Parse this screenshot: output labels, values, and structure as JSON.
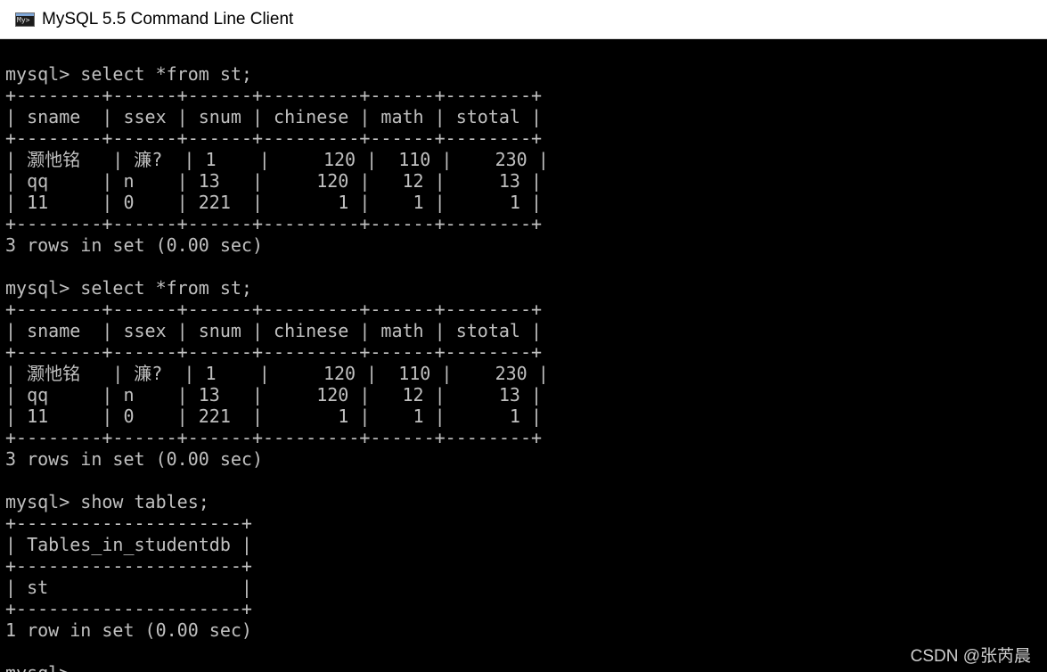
{
  "window": {
    "title": "MySQL 5.5 Command Line Client",
    "icon": "mysql-console-icon"
  },
  "console": {
    "lines": [
      "mysql> select *from st;",
      "+--------+------+------+---------+------+--------+",
      "| sname  | ssex | snum | chinese | math | stotal |",
      "+--------+------+------+---------+------+--------+",
      "| 灏忚铭   | 濂?  | 1    |     120 |  110 |    230 |",
      "| qq     | n    | 13   |     120 |   12 |     13 |",
      "| 11     | 0    | 221  |       1 |    1 |      1 |",
      "+--------+------+------+---------+------+--------+",
      "3 rows in set (0.00 sec)",
      "",
      "mysql> select *from st;",
      "+--------+------+------+---------+------+--------+",
      "| sname  | ssex | snum | chinese | math | stotal |",
      "+--------+------+------+---------+------+--------+",
      "| 灏忚铭   | 濂?  | 1    |     120 |  110 |    230 |",
      "| qq     | n    | 13   |     120 |   12 |     13 |",
      "| 11     | 0    | 221  |       1 |    1 |      1 |",
      "+--------+------+------+---------+------+--------+",
      "3 rows in set (0.00 sec)",
      "",
      "mysql> show tables;",
      "+---------------------+",
      "| Tables_in_studentdb |",
      "+---------------------+",
      "| st                  |",
      "+---------------------+",
      "1 row in set (0.00 sec)",
      "",
      "mysql>"
    ]
  },
  "watermark": "CSDN @张芮晨"
}
